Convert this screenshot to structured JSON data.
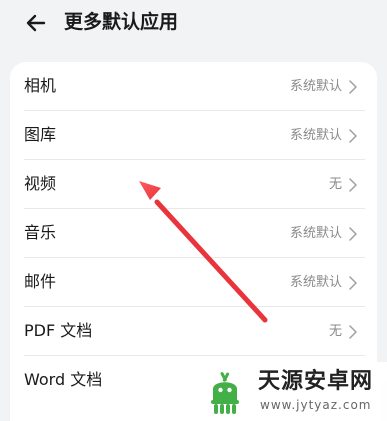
{
  "header": {
    "title": "更多默认应用",
    "back_icon": "arrow-left-icon"
  },
  "settings": {
    "items": [
      {
        "label": "相机",
        "value": "系统默认"
      },
      {
        "label": "图库",
        "value": "系统默认"
      },
      {
        "label": "视频",
        "value": "无"
      },
      {
        "label": "音乐",
        "value": "系统默认"
      },
      {
        "label": "邮件",
        "value": "系统默认"
      },
      {
        "label": "PDF 文档",
        "value": "无"
      },
      {
        "label": "Word 文档",
        "value": ""
      }
    ],
    "chevron_icon": "chevron-right-icon"
  },
  "annotation": {
    "arrow_color": "#e8343a"
  },
  "watermark": {
    "title": "天源安卓网",
    "url": "www.jytyaz.com",
    "logo_icon": "android-logo-icon",
    "logo_color": "#43b047"
  },
  "colors": {
    "background": "#f1f3f5",
    "card": "#ffffff",
    "text_primary": "#1a1a1a",
    "text_secondary": "#8a8a8a"
  }
}
